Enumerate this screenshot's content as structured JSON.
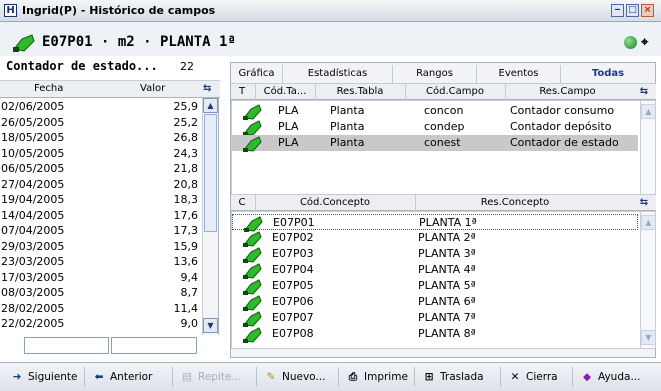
{
  "window": {
    "app_icon": "H",
    "title": "Ingrid(P) - Histórico de campos",
    "buttons": [
      "minimize-icon",
      "maximize-icon",
      "close-icon"
    ]
  },
  "header": {
    "title": "E07P01 · m2 · PLANTA 1ª",
    "icons": [
      "tag-icon",
      "globe-icon",
      "binoculars-icon"
    ]
  },
  "left_panel": {
    "title": "Contador de estado...",
    "count": "22",
    "columns": [
      "Fecha",
      "Valor"
    ],
    "rows": [
      {
        "fecha": "02/06/2005",
        "valor": "25,9"
      },
      {
        "fecha": "26/05/2005",
        "valor": "25,2"
      },
      {
        "fecha": "18/05/2005",
        "valor": "26,8"
      },
      {
        "fecha": "10/05/2005",
        "valor": "24,3"
      },
      {
        "fecha": "06/05/2005",
        "valor": "21,8"
      },
      {
        "fecha": "27/04/2005",
        "valor": "20,8"
      },
      {
        "fecha": "19/04/2005",
        "valor": "18,3"
      },
      {
        "fecha": "14/04/2005",
        "valor": "17,6"
      },
      {
        "fecha": "07/04/2005",
        "valor": "17,3"
      },
      {
        "fecha": "29/03/2005",
        "valor": "15,9"
      },
      {
        "fecha": "23/03/2005",
        "valor": "13,6"
      },
      {
        "fecha": "17/03/2005",
        "valor": "9,4"
      },
      {
        "fecha": "08/03/2005",
        "valor": "8,7"
      },
      {
        "fecha": "28/02/2005",
        "valor": "11,4"
      },
      {
        "fecha": "22/02/2005",
        "valor": "9,0"
      }
    ]
  },
  "tabs": [
    {
      "label": "Gráfica",
      "active": false
    },
    {
      "label": "Estadísticas",
      "active": false
    },
    {
      "label": "Rangos",
      "active": false
    },
    {
      "label": "Eventos",
      "active": false
    },
    {
      "label": "Todas",
      "active": true
    }
  ],
  "fields_grid": {
    "columns": [
      "T",
      "Cód.Ta...",
      "Res.Tabla",
      "Cód.Campo",
      "Res.Campo"
    ],
    "rows": [
      {
        "cod_tabla": "PLA",
        "res_tabla": "Planta",
        "cod_campo": "concon",
        "res_campo": "Contador consumo",
        "selected": false
      },
      {
        "cod_tabla": "PLA",
        "res_tabla": "Planta",
        "cod_campo": "condep",
        "res_campo": "Contador depósito",
        "selected": false
      },
      {
        "cod_tabla": "PLA",
        "res_tabla": "Planta",
        "cod_campo": "conest",
        "res_campo": "Contador de estado",
        "selected": true
      }
    ]
  },
  "concepts_grid": {
    "columns": [
      "C",
      "Cód.Concepto",
      "Res.Concepto"
    ],
    "rows": [
      {
        "cod": "E07P01",
        "res": "PLANTA 1ª"
      },
      {
        "cod": "E07P02",
        "res": "PLANTA 2ª"
      },
      {
        "cod": "E07P03",
        "res": "PLANTA 3ª"
      },
      {
        "cod": "E07P04",
        "res": "PLANTA 4ª"
      },
      {
        "cod": "E07P05",
        "res": "PLANTA 5ª"
      },
      {
        "cod": "E07P06",
        "res": "PLANTA 6ª"
      },
      {
        "cod": "E07P07",
        "res": "PLANTA 7ª"
      },
      {
        "cod": "E07P08",
        "res": "PLANTA 8ª"
      }
    ]
  },
  "toolbar": {
    "siguiente": "Siguiente",
    "anterior": "Anterior",
    "repite": "Repite...",
    "nuevo": "Nuevo...",
    "imprime": "Imprime",
    "traslada": "Traslada",
    "cierra": "Cierra",
    "ayuda": "Ayuda..."
  },
  "colors": {
    "tag_green": "#2dbb2d",
    "selection": "#c9c9c9",
    "active_tab": "#1b3a8a"
  }
}
